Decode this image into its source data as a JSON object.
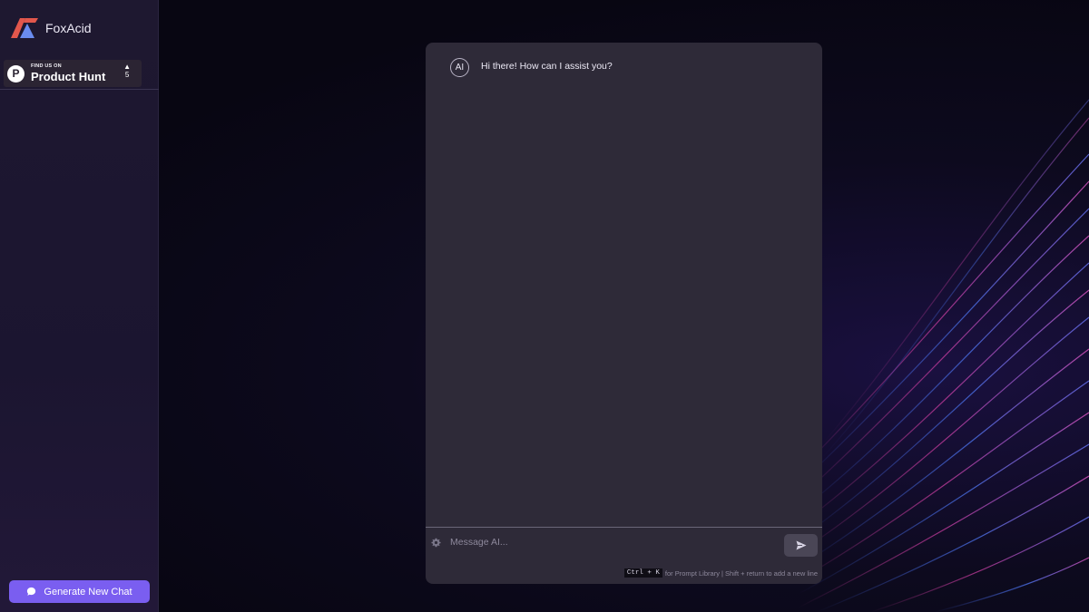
{
  "brand": {
    "name": "FoxAcid"
  },
  "product_hunt": {
    "small_label": "FIND US ON",
    "big_label": "Product Hunt",
    "votes": "5"
  },
  "sidebar": {
    "new_chat_label": "Generate New Chat"
  },
  "chat": {
    "avatar_label": "AI",
    "greeting": "Hi there! How can I assist you?",
    "input_placeholder": "Message AI...",
    "hint_shortcut": "Ctrl + K",
    "hint_text": "for Prompt Library | Shift + return to add a new line"
  },
  "colors": {
    "accent": "#7a5ef0",
    "panel": "#2e2a38",
    "sidebar": "#1e1830"
  },
  "icons": {
    "logo": "foxacid-logo",
    "settings": "gear-icon",
    "send": "send-icon",
    "chat": "chat-bubble-icon"
  }
}
